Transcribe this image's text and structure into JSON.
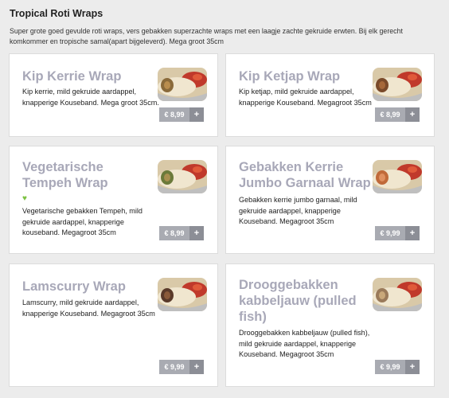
{
  "section": {
    "title": "Tropical Roti Wraps",
    "description": "Super grote goed gevulde roti wraps, vers gebakken superzachte wraps met een laagje zachte gekruide erwten. Bij elk gerecht komkommer en tropische samal(apart bijgeleverd). Mega groot 35cm"
  },
  "items": [
    {
      "title": "Kip Kerrie Wrap",
      "desc": "Kip kerrie, mild gekruide aardappel, knapperige Kouseband. Mega groot 35cm.",
      "price": "€ 8,99",
      "add": "+",
      "veg": false
    },
    {
      "title": "Kip Ketjap Wrap",
      "desc": "Kip ketjap, mild gekruide aardappel, knapperige Kouseband. Megagroot 35cm",
      "price": "€ 8,99",
      "add": "+",
      "veg": false
    },
    {
      "title": "Vegetarische Tempeh Wrap",
      "desc": "Vegetarische gebakken Tempeh, mild gekruide aardappel, knapperige kouseband. Megagroot 35cm",
      "price": "€ 8,99",
      "add": "+",
      "veg": true
    },
    {
      "title": "Gebakken Kerrie Jumbo Garnaal Wrap",
      "desc": "Gebakken kerrie jumbo garnaal, mild gekruide aardappel, knapperige Kouseband. Megagroot 35cm",
      "price": "€ 9,99",
      "add": "+",
      "veg": false
    },
    {
      "title": "Lamscurry Wrap",
      "desc": "Lamscurry, mild gekruide aardappel, knapperige Kouseband. Megagroot 35cm",
      "price": "€ 9,99",
      "add": "+",
      "veg": false
    },
    {
      "title": "Drooggebakken kabbeljauw (pulled fish)",
      "desc": "Drooggebakken kabbeljauw (pulled fish), mild gekruide aardappel, knapperige Kouseband. Megagroot 35cm",
      "price": "€ 9,99",
      "add": "+",
      "veg": false
    }
  ],
  "colors": {
    "title": "#a8a8b8",
    "price_bg": "#a9abb2",
    "add_bg": "#8c8e96",
    "veg": "#7cc242"
  },
  "icons": {
    "veg": "vegetarian-heart-icon"
  }
}
